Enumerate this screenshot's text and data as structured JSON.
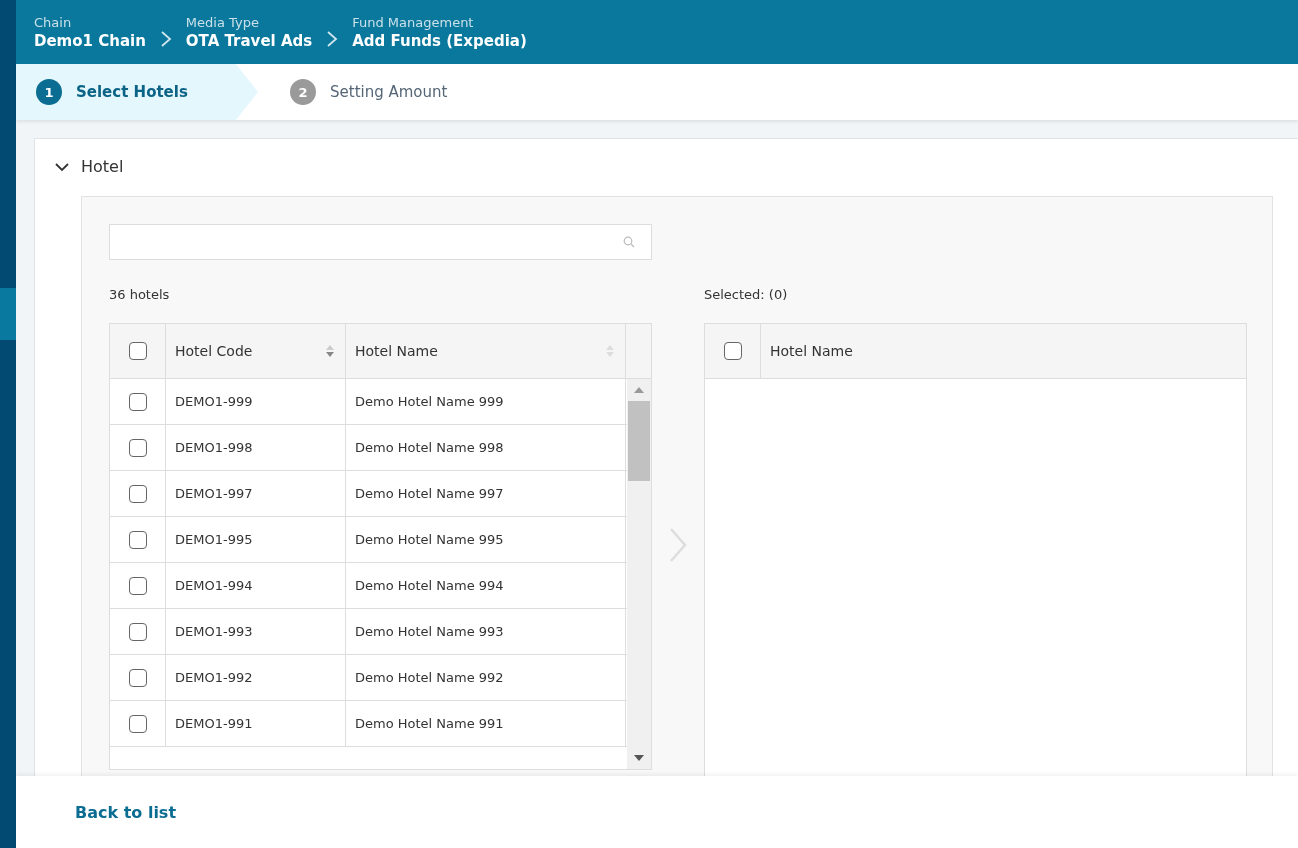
{
  "breadcrumb": [
    {
      "label": "Chain",
      "value": "Demo1 Chain"
    },
    {
      "label": "Media Type",
      "value": "OTA Travel Ads"
    },
    {
      "label": "Fund Management",
      "value": "Add Funds (Expedia)"
    }
  ],
  "steps": [
    {
      "number": "1",
      "label": "Select Hotels",
      "selected": true
    },
    {
      "number": "2",
      "label": "Setting Amount",
      "selected": false
    }
  ],
  "section": {
    "title": "Hotel",
    "expanded": true
  },
  "available": {
    "count": "36 hotels",
    "all_checked": false,
    "columns": [
      "Hotel Code",
      "Hotel Name"
    ],
    "rows": [
      {
        "code": "DEMO1-999",
        "name": "Demo Hotel Name 999",
        "checked": false
      },
      {
        "code": "DEMO1-998",
        "name": "Demo Hotel Name 998",
        "checked": false
      },
      {
        "code": "DEMO1-997",
        "name": "Demo Hotel Name 997",
        "checked": false
      },
      {
        "code": "DEMO1-995",
        "name": "Demo Hotel Name 995",
        "checked": false
      },
      {
        "code": "DEMO1-994",
        "name": "Demo Hotel Name 994",
        "checked": false
      },
      {
        "code": "DEMO1-993",
        "name": "Demo Hotel Name 993",
        "checked": false
      },
      {
        "code": "DEMO1-992",
        "name": "Demo Hotel Name 992",
        "checked": false
      },
      {
        "code": "DEMO1-991",
        "name": "Demo Hotel Name 991",
        "checked": false
      }
    ]
  },
  "selected": {
    "count": "Selected: (0)",
    "all_checked": false,
    "columns": [
      "Hotel Name"
    ]
  },
  "footer": {
    "back_link": "Back to list"
  }
}
